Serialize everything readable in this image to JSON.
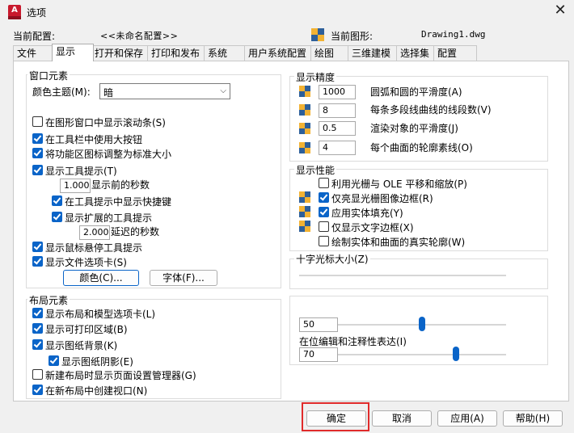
{
  "window": {
    "title": "选项",
    "app_icon_letter": "A"
  },
  "header": {
    "profile_label": "当前配置:",
    "profile_value": "<<未命名配置>>",
    "drawing_label": "当前图形:",
    "drawing_value": "Drawing1.dwg"
  },
  "tabs": [
    "文件",
    "显示",
    "打开和保存",
    "打印和发布",
    "系统",
    "用户系统配置",
    "绘图",
    "三维建模",
    "选择集",
    "配置"
  ],
  "active_tab": "显示",
  "window_elements": {
    "title": "窗口元素",
    "color_scheme_label": "颜色主题(M):",
    "color_scheme_value": "暗",
    "scrollbars": "在图形窗口中显示滚动条(S)",
    "large_buttons": "在工具栏中使用大按钮",
    "resize_ribbon": "将功能区图标调整为标准大小",
    "show_tooltips": "显示工具提示(T)",
    "delay_value": "1.000",
    "delay_label": "显示前的秒数",
    "shortcut_keys": "在工具提示中显示快捷键",
    "extended_tooltips": "显示扩展的工具提示",
    "ext_delay_value": "2.000",
    "ext_delay_label": "延迟的秒数",
    "rollover": "显示鼠标悬停工具提示",
    "file_tabs": "显示文件选项卡(S)",
    "colors_button": "颜色(C)...",
    "fonts_button": "字体(F)..."
  },
  "layout_elements": {
    "title": "布局元素",
    "layout_model_tabs": "显示布局和模型选项卡(L)",
    "printable_area": "显示可打印区域(B)",
    "paper_background": "显示图纸背景(K)",
    "paper_shadow": "显示图纸阴影(E)",
    "page_setup_manager": "新建布局时显示页面设置管理器(G)",
    "create_viewport": "在新布局中创建视口(N)"
  },
  "display_resolution": {
    "title": "显示精度",
    "arc_value": "1000",
    "arc_label": "圆弧和圆的平滑度(A)",
    "polyline_value": "8",
    "polyline_label": "每条多段线曲线的线段数(V)",
    "render_value": "0.5",
    "render_label": "渲染对象的平滑度(J)",
    "contour_value": "4",
    "contour_label": "每个曲面的轮廓素线(O)"
  },
  "display_performance": {
    "title": "显示性能",
    "raster_pan": "利用光栅与 OLE 平移和缩放(P)",
    "highlight_raster": "仅亮显光栅图像边框(R)",
    "solid_fill": "应用实体填充(Y)",
    "text_boundary": "仅显示文字边框(X)",
    "silhouettes": "绘制实体和曲面的真实轮廓(W)"
  },
  "crosshair": {
    "title": "十字光标大小(Z)"
  },
  "fade": {
    "xref_value": "50",
    "inplace_label": "在位编辑和注释性表达(I)",
    "inplace_value": "70",
    "xref_level": 0.5,
    "inplace_level": 0.7
  },
  "footer": {
    "ok": "确定",
    "cancel": "取消",
    "apply": "应用(A)",
    "help": "帮助(H)"
  },
  "colors": {
    "accent": "#0a64c8",
    "highlight": "#e02b2b",
    "app_icon": "#c8192d"
  }
}
